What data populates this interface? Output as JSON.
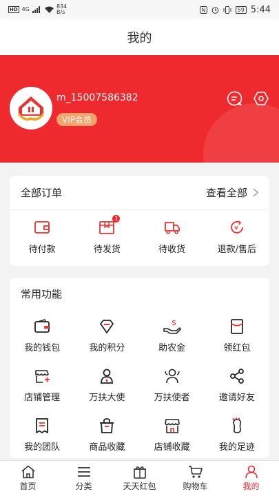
{
  "statusbar": {
    "hd": "HD",
    "net": "4G",
    "speed": "834",
    "speed_unit": "B/s",
    "battery": "59",
    "time": "5:44"
  },
  "header": {
    "title": "我的"
  },
  "profile": {
    "username": "m_15007586382",
    "vip": "VIP会员"
  },
  "orders": {
    "title": "全部订单",
    "more": "查看全部",
    "items": [
      {
        "label": "待付款"
      },
      {
        "label": "待发货",
        "badge": "1"
      },
      {
        "label": "待收货"
      },
      {
        "label": "退款/售后"
      }
    ]
  },
  "functions": {
    "title": "常用功能",
    "items": [
      {
        "label": "我的钱包"
      },
      {
        "label": "我的积分"
      },
      {
        "label": "助农金"
      },
      {
        "label": "领红包"
      },
      {
        "label": "店铺管理"
      },
      {
        "label": "万扶大使"
      },
      {
        "label": "万扶使者"
      },
      {
        "label": "邀请好友"
      },
      {
        "label": "我的团队"
      },
      {
        "label": "商品收藏"
      },
      {
        "label": "店铺收藏"
      },
      {
        "label": "我的足迹"
      }
    ]
  },
  "tabbar": {
    "items": [
      {
        "label": "首页"
      },
      {
        "label": "分类"
      },
      {
        "label": "天天红包"
      },
      {
        "label": "购物车"
      },
      {
        "label": "我的"
      }
    ]
  },
  "colors": {
    "accent": "#ef2a2e",
    "vip": "#f7a26b"
  }
}
